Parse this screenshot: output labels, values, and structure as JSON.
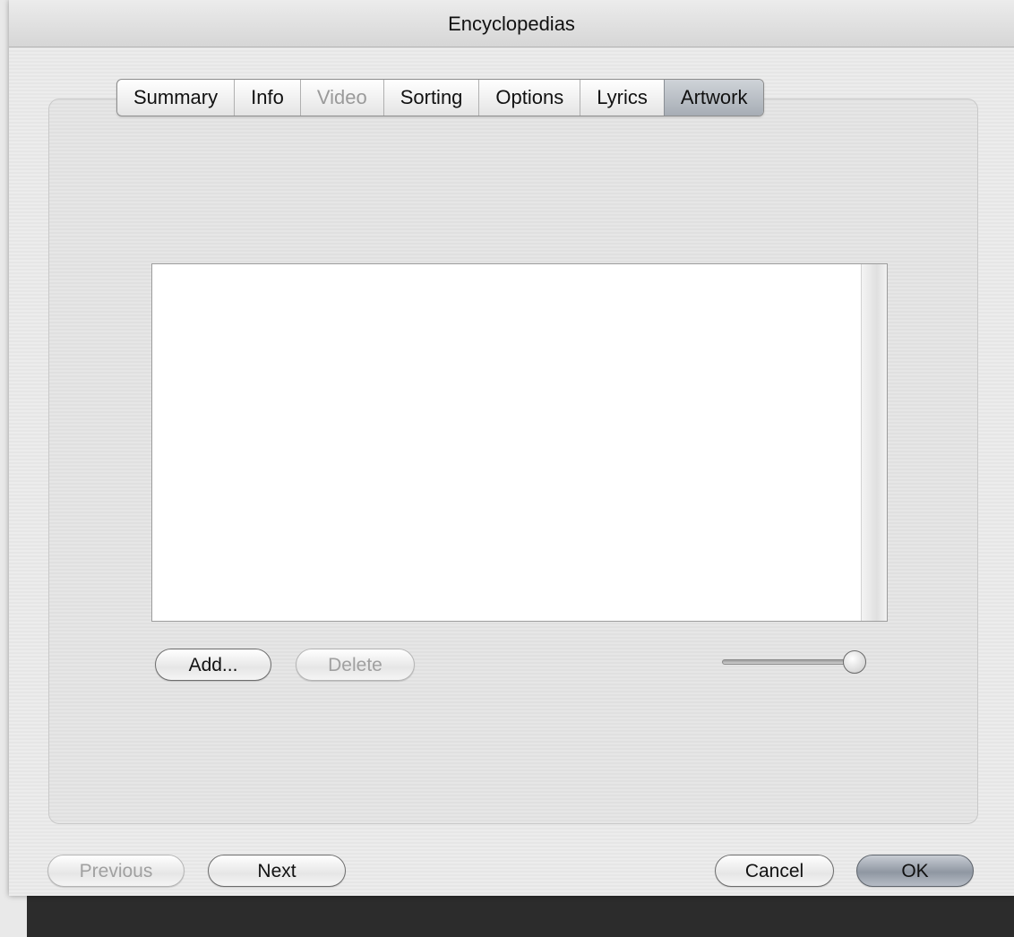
{
  "window": {
    "title": "Encyclopedias"
  },
  "tabs": [
    {
      "label": "Summary",
      "state": "normal"
    },
    {
      "label": "Info",
      "state": "normal"
    },
    {
      "label": "Video",
      "state": "disabled"
    },
    {
      "label": "Sorting",
      "state": "normal"
    },
    {
      "label": "Options",
      "state": "normal"
    },
    {
      "label": "Lyrics",
      "state": "normal"
    },
    {
      "label": "Artwork",
      "state": "selected"
    }
  ],
  "artwork": {
    "add_label": "Add...",
    "delete_label": "Delete",
    "size_slider_value": 0.95
  },
  "footer": {
    "previous_label": "Previous",
    "next_label": "Next",
    "cancel_label": "Cancel",
    "ok_label": "OK"
  },
  "colors": {
    "selected_tab": "#a7adb5",
    "default_button": "#8f97a2",
    "disabled_text": "#9a9a9a"
  }
}
